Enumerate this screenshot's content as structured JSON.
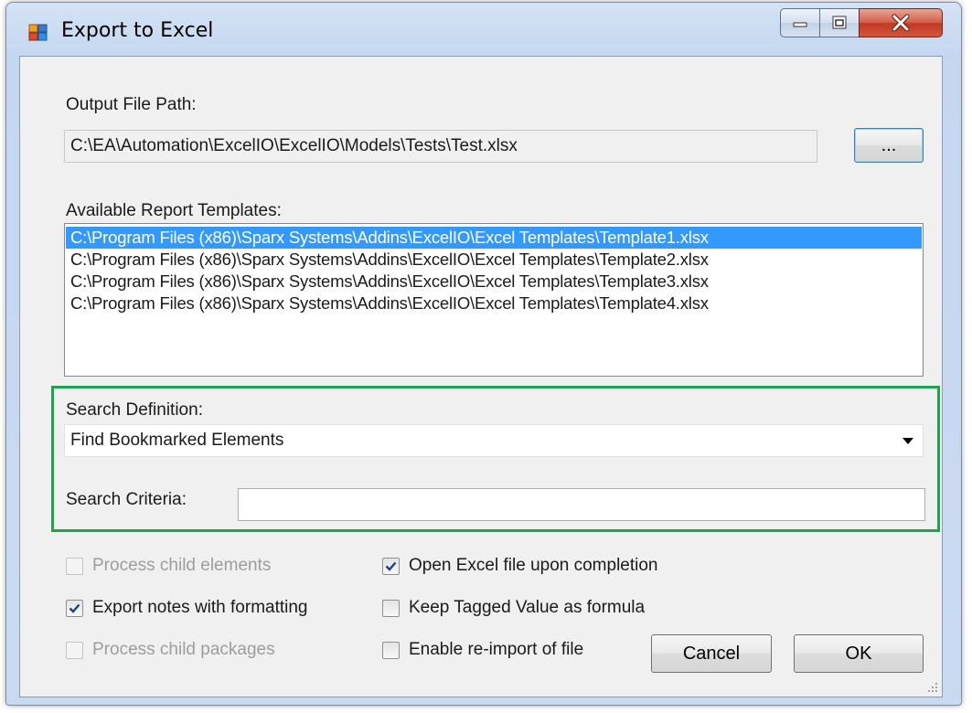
{
  "window": {
    "title": "Export to Excel",
    "controls": {
      "minimize": "minimize",
      "maximize": "maximize",
      "close": "close"
    }
  },
  "output": {
    "label": "Output File Path:",
    "value": "C:\\EA\\Automation\\ExcelIO\\ExcelIO\\Models\\Tests\\Test.xlsx",
    "browse_label": "..."
  },
  "templates": {
    "label": "Available Report Templates:",
    "items": [
      {
        "label": "C:\\Program Files (x86)\\Sparx Systems\\Addins\\ExcelIO\\Excel Templates\\Template1.xlsx",
        "selected": true
      },
      {
        "label": "C:\\Program Files (x86)\\Sparx Systems\\Addins\\ExcelIO\\Excel Templates\\Template2.xlsx",
        "selected": false
      },
      {
        "label": "C:\\Program Files (x86)\\Sparx Systems\\Addins\\ExcelIO\\Excel Templates\\Template3.xlsx",
        "selected": false
      },
      {
        "label": "C:\\Program Files (x86)\\Sparx Systems\\Addins\\ExcelIO\\Excel Templates\\Template4.xlsx",
        "selected": false
      }
    ]
  },
  "search": {
    "definition_label": "Search Definition:",
    "definition_value": "Find Bookmarked Elements",
    "criteria_label": "Search Criteria:",
    "criteria_value": "",
    "highlight_color": "#1aa74a"
  },
  "options": [
    {
      "label": "Process child elements",
      "checked": false,
      "enabled": false
    },
    {
      "label": "Open Excel file upon completion",
      "checked": true,
      "enabled": true
    },
    {
      "label": "Export notes with formatting",
      "checked": true,
      "enabled": true
    },
    {
      "label": "Keep Tagged Value as formula",
      "checked": false,
      "enabled": true
    },
    {
      "label": "Process child packages",
      "checked": false,
      "enabled": false
    },
    {
      "label": "Enable re-import of file",
      "checked": false,
      "enabled": true
    }
  ],
  "buttons": {
    "cancel": "Cancel",
    "ok": "OK"
  },
  "colors": {
    "selection": "#3399ff",
    "title_gradient": "#c5d7ef",
    "close_button": "#c23a22"
  }
}
